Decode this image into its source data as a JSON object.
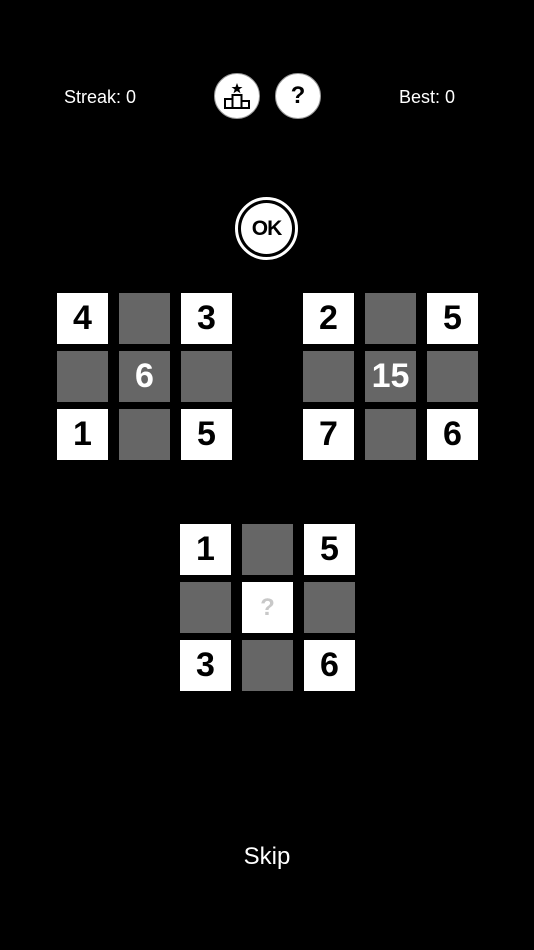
{
  "header": {
    "streak": "Streak: 0",
    "best": "Best: 0",
    "leaderboard_icon": "podium-icon",
    "help_label": "?"
  },
  "ok_label": "OK",
  "skip_label": "Skip",
  "colors": {
    "background": "#000000",
    "tile_white": "#ffffff",
    "tile_gray": "#666666"
  },
  "puzzles": {
    "left": {
      "tl": "4",
      "tr": "3",
      "center": "6",
      "bl": "1",
      "br": "5"
    },
    "right": {
      "tl": "2",
      "tr": "5",
      "center": "15",
      "bl": "7",
      "br": "6"
    },
    "bottom": {
      "tl": "1",
      "tr": "5",
      "center": "?",
      "bl": "3",
      "br": "6"
    }
  }
}
